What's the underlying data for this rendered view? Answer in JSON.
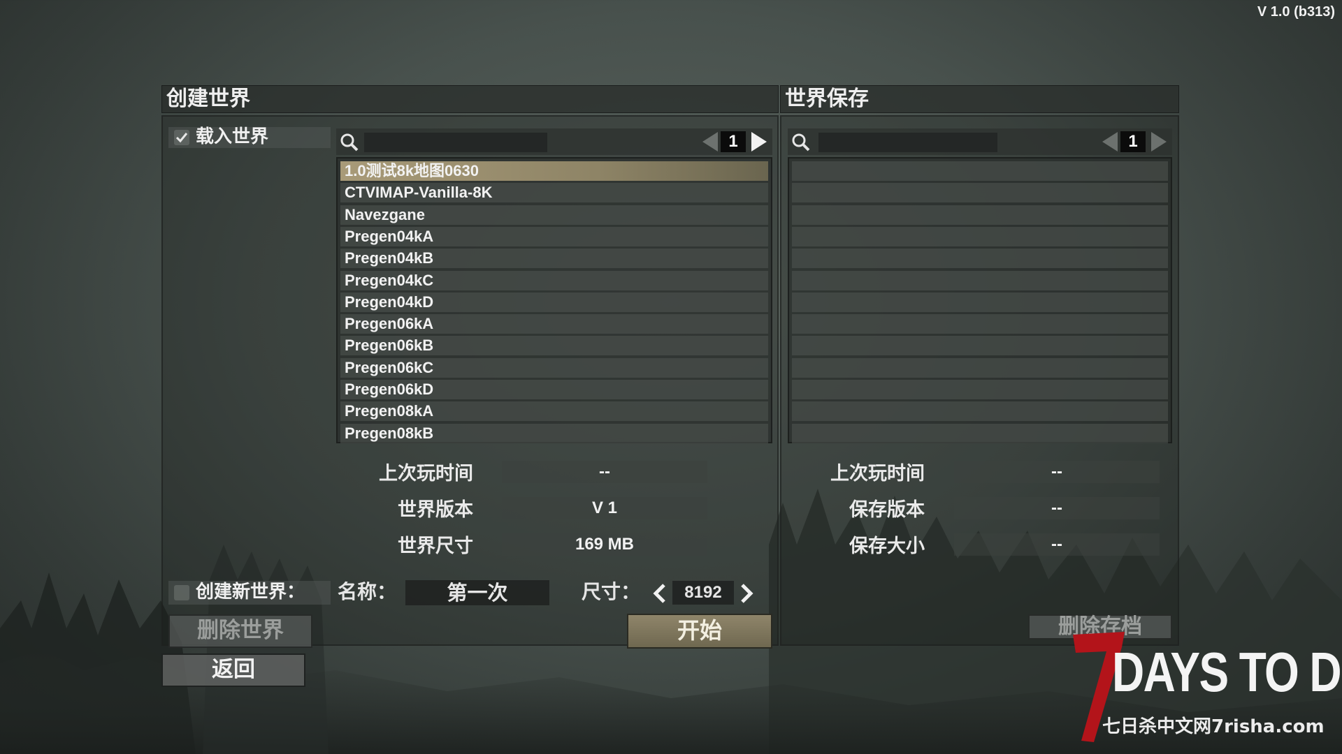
{
  "version": "V 1.0 (b313)",
  "left_panel": {
    "title": "创建世界",
    "load_world_label": "载入世界",
    "page_number": "1",
    "worlds": [
      "1.0测试8k地图0630",
      "CTVIMAP-Vanilla-8K",
      "Navezgane",
      "Pregen04kA",
      "Pregen04kB",
      "Pregen04kC",
      "Pregen04kD",
      "Pregen06kA",
      "Pregen06kB",
      "Pregen06kC",
      "Pregen06kD",
      "Pregen08kA",
      "Pregen08kB"
    ],
    "info": [
      {
        "label": "上次玩时间",
        "value": "--"
      },
      {
        "label": "世界版本",
        "value": "V 1"
      },
      {
        "label": "世界尺寸",
        "value": "169 MB"
      }
    ],
    "create_new_label": "创建新世界：",
    "name_label": "名称：",
    "name_value": "第一次",
    "size_label": "尺寸：",
    "size_value": "8192",
    "delete_world": "删除世界",
    "start": "开始"
  },
  "right_panel": {
    "title": "世界保存",
    "page_number": "1",
    "info": [
      {
        "label": "上次玩时间",
        "value": "--"
      },
      {
        "label": "保存版本",
        "value": "--"
      },
      {
        "label": "保存大小",
        "value": "--"
      }
    ],
    "delete_save": "删除存档"
  },
  "back": "返回",
  "logo": {
    "seven": "7",
    "title": "DAYS TO DIE",
    "subtitle": "七日杀中文网7risha.com"
  }
}
